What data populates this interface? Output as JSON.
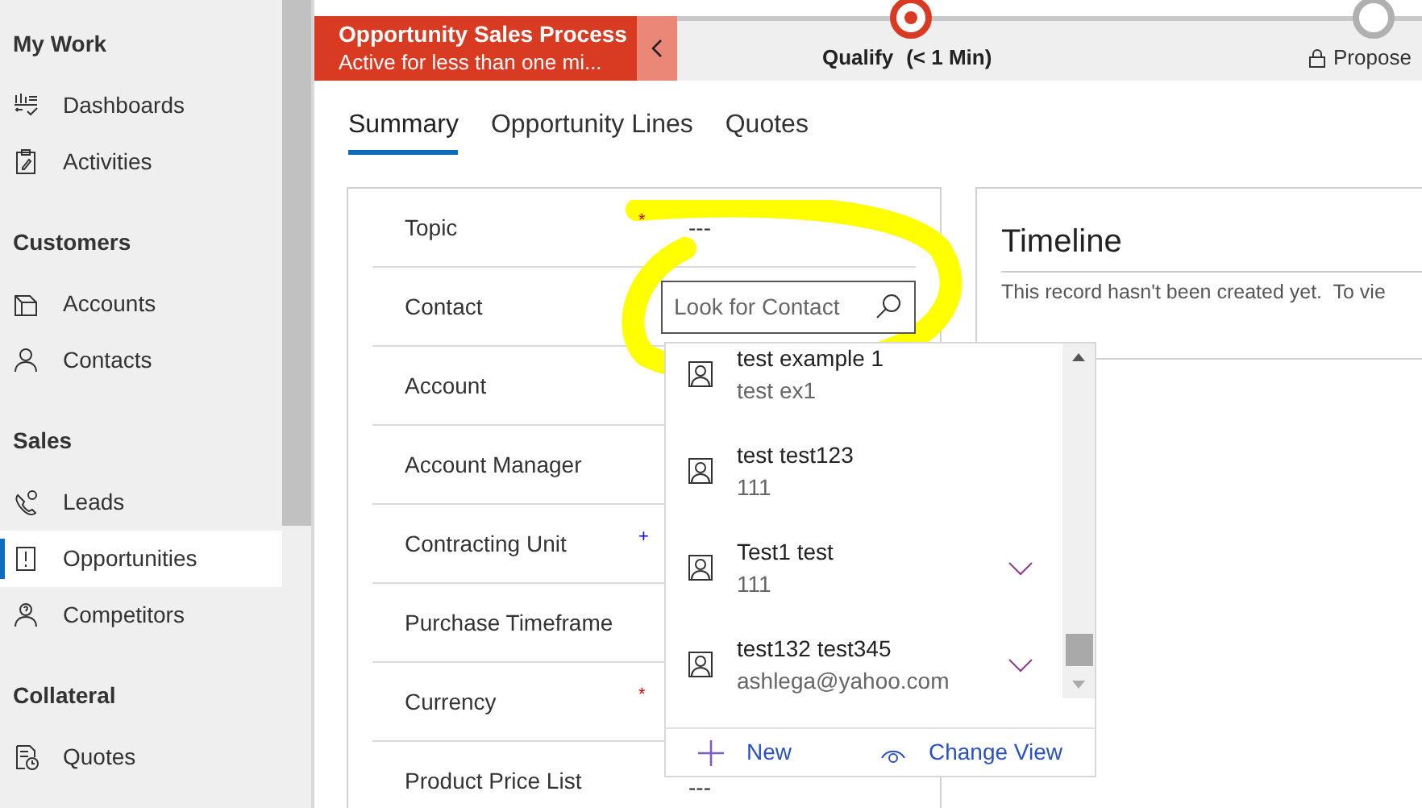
{
  "sidebar": {
    "groups": [
      {
        "title": "My Work",
        "items": [
          {
            "label": "Dashboards",
            "kind": "dashboard",
            "selected": false
          },
          {
            "label": "Activities",
            "kind": "clipboard",
            "selected": false
          }
        ]
      },
      {
        "title": "Customers",
        "items": [
          {
            "label": "Accounts",
            "kind": "building",
            "selected": false
          },
          {
            "label": "Contacts",
            "kind": "person",
            "selected": false
          }
        ]
      },
      {
        "title": "Sales",
        "items": [
          {
            "label": "Leads",
            "kind": "phone",
            "selected": false
          },
          {
            "label": "Opportunities",
            "kind": "alert",
            "selected": true
          },
          {
            "label": "Competitors",
            "kind": "competitor",
            "selected": false
          }
        ]
      },
      {
        "title": "Collateral",
        "items": [
          {
            "label": "Quotes",
            "kind": "quote",
            "selected": false
          }
        ]
      }
    ]
  },
  "process": {
    "title": "Opportunity Sales Process",
    "subtitle": "Active for less than one mi...",
    "stages": [
      {
        "label": "Qualify",
        "duration": "(< 1 Min)",
        "active": true,
        "locked": false
      },
      {
        "label": "Propose",
        "active": false,
        "locked": true
      }
    ]
  },
  "tabs": [
    {
      "label": "Summary",
      "selected": true
    },
    {
      "label": "Opportunity Lines",
      "selected": false
    },
    {
      "label": "Quotes",
      "selected": false
    }
  ],
  "form": {
    "fields": [
      {
        "label": "Topic",
        "marker": {
          "text": "*",
          "kind": "required"
        },
        "value": "---"
      },
      {
        "label": "Contact",
        "kind": "lookup",
        "placeholder": "Look for Contact"
      },
      {
        "label": "Account"
      },
      {
        "label": "Account Manager"
      },
      {
        "label": "Contracting Unit",
        "marker": {
          "text": "+",
          "kind": "recommended"
        }
      },
      {
        "label": "Purchase Timeframe"
      },
      {
        "label": "Currency",
        "marker": {
          "text": "*",
          "kind": "required"
        }
      },
      {
        "label": "Product Price List",
        "value": "---"
      }
    ]
  },
  "lookup": {
    "results": [
      {
        "name": "test example 1",
        "detail": "test ex1",
        "expandable": false
      },
      {
        "name": "test test123",
        "detail": "111",
        "expandable": false
      },
      {
        "name": "Test1 test",
        "detail": "111",
        "expandable": true
      },
      {
        "name": "test132 test345",
        "detail": "ashlega@yahoo.com",
        "expandable": true
      }
    ],
    "actions": [
      {
        "label": "New",
        "kind": "new"
      },
      {
        "label": "Change View",
        "kind": "view"
      }
    ]
  },
  "timeline": {
    "title": "Timeline",
    "message": "This record hasn't been created yet.  To vie"
  }
}
